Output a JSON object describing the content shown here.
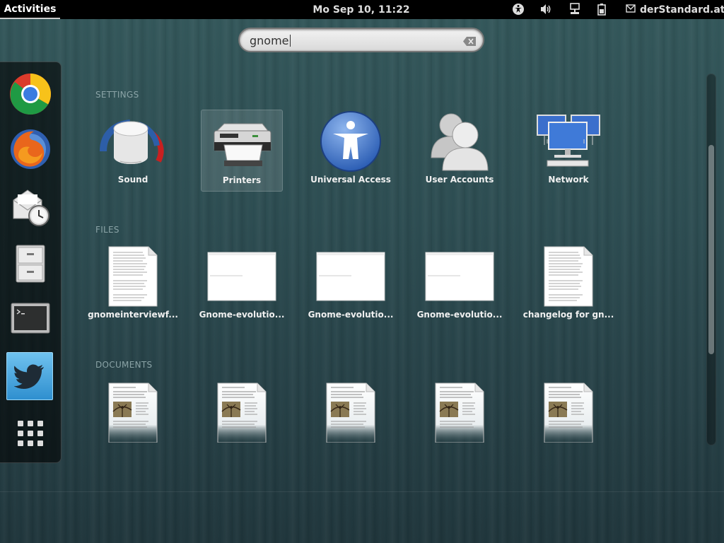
{
  "top_panel": {
    "activities": "Activities",
    "clock": "Mo Sep 10, 11:22",
    "user_label": "derStandard.at",
    "tray_icons": [
      "accessibility-icon",
      "volume-icon",
      "network-wired-icon",
      "battery-icon",
      "mail-icon"
    ]
  },
  "search": {
    "value": "gnome"
  },
  "dash": {
    "items": [
      {
        "name": "chrome-icon"
      },
      {
        "name": "firefox-icon"
      },
      {
        "name": "evolution-mail-icon"
      },
      {
        "name": "file-cabinet-icon"
      },
      {
        "name": "terminal-icon"
      },
      {
        "name": "twitter-icon"
      },
      {
        "name": "show-applications-icon"
      }
    ]
  },
  "sections": {
    "settings": "SETTINGS",
    "files": "FILES",
    "documents": "DOCUMENTS"
  },
  "settings_items": [
    {
      "label": "Sound",
      "icon": "speaker-icon"
    },
    {
      "label": "Printers",
      "icon": "printer-icon"
    },
    {
      "label": "Universal Access",
      "icon": "universal-access-icon"
    },
    {
      "label": "User Accounts",
      "icon": "user-accounts-icon"
    },
    {
      "label": "Network",
      "icon": "network-icon"
    }
  ],
  "files_items": [
    {
      "label": "gnomeinterviewf...",
      "icon": "text-document-icon"
    },
    {
      "label": "Gnome-evolutio...",
      "icon": "image-thumbnail-icon"
    },
    {
      "label": "Gnome-evolutio...",
      "icon": "image-thumbnail-icon"
    },
    {
      "label": "Gnome-evolutio...",
      "icon": "image-thumbnail-icon"
    },
    {
      "label": "changelog for gn...",
      "icon": "text-document-icon"
    }
  ],
  "documents_items": [
    {
      "icon": "document-thumbnail-icon"
    },
    {
      "icon": "document-thumbnail-icon"
    },
    {
      "icon": "document-thumbnail-icon"
    },
    {
      "icon": "document-thumbnail-icon"
    },
    {
      "icon": "document-thumbnail-icon"
    }
  ],
  "colors": {
    "panel": "#000000",
    "background": "#2c4c51",
    "section_title": "#8aa3a6",
    "accent_blue": "#3b73c9"
  }
}
